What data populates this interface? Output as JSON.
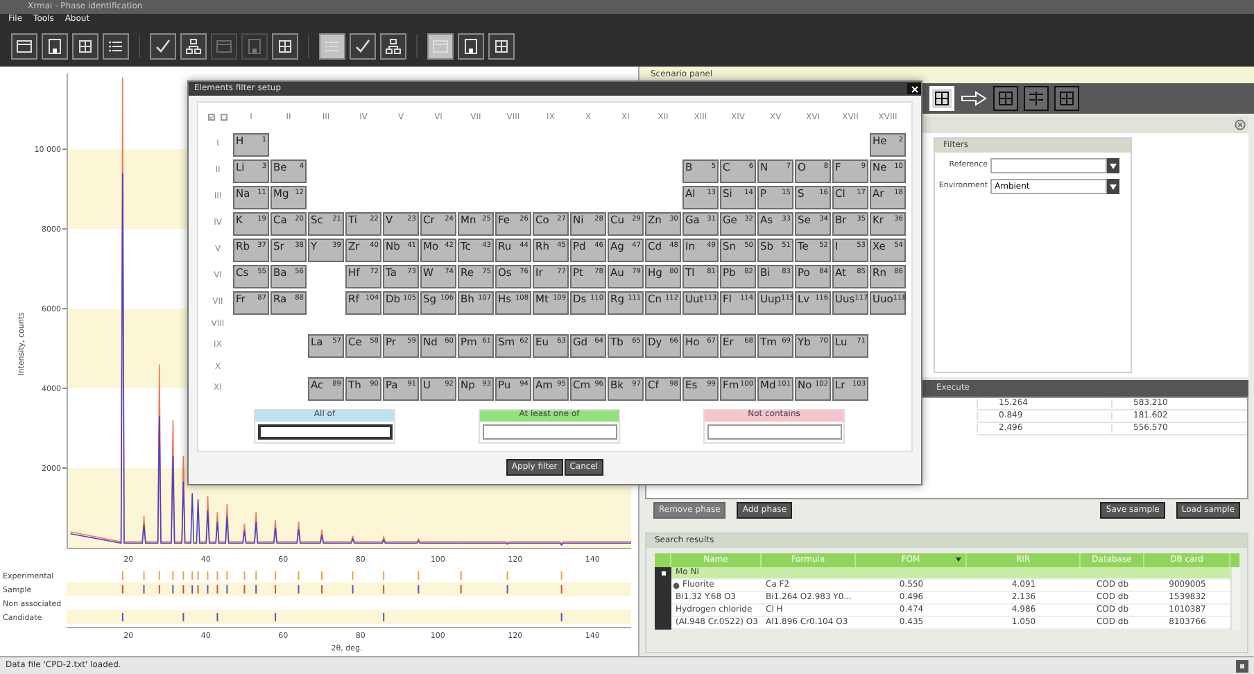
{
  "window": {
    "title": "Xrmai - Phase identification"
  },
  "menu": [
    {
      "label": "File"
    },
    {
      "label": "Tools"
    },
    {
      "label": "About"
    }
  ],
  "toolbar": [
    {
      "selected": false,
      "disabled": false,
      "separator_after": false
    },
    {
      "selected": false,
      "disabled": false,
      "separator_after": false
    },
    {
      "selected": false,
      "disabled": false,
      "separator_after": false
    },
    {
      "selected": false,
      "disabled": false,
      "separator_after": true
    },
    {
      "selected": false,
      "disabled": false,
      "separator_after": false
    },
    {
      "selected": false,
      "disabled": false,
      "separator_after": false
    },
    {
      "selected": false,
      "disabled": true,
      "separator_after": false
    },
    {
      "selected": false,
      "disabled": true,
      "separator_after": false
    },
    {
      "selected": false,
      "disabled": false,
      "separator_after": true
    },
    {
      "selected": true,
      "disabled": false,
      "separator_after": false
    },
    {
      "selected": false,
      "disabled": false,
      "separator_after": false
    },
    {
      "selected": false,
      "disabled": false,
      "separator_after": true
    },
    {
      "selected": true,
      "disabled": false,
      "separator_after": false
    },
    {
      "selected": false,
      "disabled": false,
      "separator_after": false
    },
    {
      "selected": false,
      "disabled": false,
      "separator_after": false
    }
  ],
  "plot": {
    "chart_data": {
      "type": "line",
      "ylabel": "Intensity, counts",
      "xlim": [
        4,
        150
      ],
      "ylim": [
        0,
        11900
      ],
      "xticks": [
        20,
        40,
        60,
        80,
        100,
        120,
        140
      ],
      "yticks": [
        2000,
        4000,
        6000,
        8000,
        {
          "value": 10000,
          "label": "10 000"
        }
      ],
      "x": [
        5,
        18.1,
        18.5,
        18.9,
        23.6,
        24,
        24.4,
        27.6,
        28,
        28.4,
        31.1,
        31.5,
        31.9,
        33.8,
        34.2,
        34.6,
        36.1,
        36.5,
        36.9,
        37.6,
        38,
        38.4,
        40.1,
        40.5,
        40.9,
        42.6,
        43,
        43.4,
        45.1,
        45.5,
        45.9,
        49.6,
        50,
        50.4,
        52.6,
        53,
        53.4,
        57.6,
        58,
        58.4,
        63.6,
        64,
        64.4,
        69.6,
        70,
        70.4,
        77.6,
        78,
        78.4,
        85.6,
        86,
        86.4,
        94.6,
        95,
        95.4,
        105.6,
        106,
        106.4,
        117.6,
        118,
        118.4,
        131.6,
        132,
        132.4,
        150
      ],
      "series": [
        {
          "color": "#f07a5a",
          "values": [
            400,
            150,
            11800,
            150,
            150,
            800,
            150,
            150,
            4600,
            150,
            150,
            3200,
            150,
            150,
            2300,
            150,
            150,
            null,
            null,
            null,
            null,
            150,
            150,
            1300,
            150,
            150,
            900,
            150,
            150,
            1100,
            150,
            150,
            600,
            150,
            150,
            900,
            150,
            150,
            700,
            150,
            150,
            650,
            150,
            150,
            450,
            150,
            150,
            300,
            150,
            150,
            280,
            150,
            150,
            220,
            150,
            150,
            160,
            150,
            150,
            120,
            150,
            150,
            100,
            150,
            150
          ]
        },
        {
          "color": "#4b3fcf",
          "values": [
            350,
            120,
            9400,
            120,
            120,
            580,
            120,
            120,
            3310,
            120,
            120,
            2300,
            120,
            120,
            1660,
            120,
            120,
            1370,
            120,
            120,
            1220,
            120,
            120,
            940,
            120,
            120,
            650,
            120,
            120,
            790,
            120,
            120,
            430,
            120,
            120,
            650,
            120,
            120,
            500,
            120,
            120,
            470,
            120,
            120,
            320,
            120,
            120,
            220,
            120,
            120,
            200,
            120,
            120,
            160,
            120,
            120,
            120,
            120,
            120,
            90,
            120,
            120,
            70,
            120,
            120
          ]
        }
      ]
    },
    "tracks": [
      {
        "label": "Experimental"
      },
      {
        "label": "Sample"
      },
      {
        "label": "Non associated"
      },
      {
        "label": "Candidate"
      }
    ],
    "bottom_x_ticks": [
      "20",
      "40",
      "60",
      "80",
      "100",
      "120",
      "140"
    ],
    "x_label": "2θ, deg."
  },
  "scenario_panel": {
    "title": "Scenario panel",
    "tools": [
      {
        "kind": "button",
        "selected": true
      },
      {
        "kind": "arrow"
      },
      {
        "kind": "button",
        "selected": false
      },
      {
        "kind": "button",
        "selected": false
      },
      {
        "kind": "button",
        "selected": false
      }
    ],
    "filters": {
      "title": "Filters",
      "fields": [
        {
          "label": "Reference"
        },
        {
          "label": "Environment",
          "value": "Ambient"
        }
      ]
    },
    "execute": {
      "title": "Execute",
      "rows": [
        [
          "15.264",
          "583.210"
        ],
        [
          "0.849",
          "181.602"
        ],
        [
          "2.496",
          "556.570"
        ]
      ]
    },
    "left_buttons": [
      {
        "label": "Remove phase",
        "disabled": true
      },
      {
        "label": "Add phase",
        "disabled": false
      }
    ],
    "right_buttons": [
      {
        "label": "Save sample",
        "disabled": false
      },
      {
        "label": "Load sample",
        "disabled": false
      }
    ]
  },
  "search_results": {
    "title": "Search results",
    "columns": [
      {
        "label": "Name",
        "sorted": false
      },
      {
        "label": "Formula",
        "sorted": false
      },
      {
        "label": "FOM",
        "sorted": true
      },
      {
        "label": "RIR",
        "sorted": false
      },
      {
        "label": "Database",
        "sorted": false
      },
      {
        "label": "DB card",
        "sorted": false
      }
    ],
    "rows": [
      {
        "selected": true,
        "current": false,
        "cells": [
          "Mo Ni"
        ]
      },
      {
        "selected": false,
        "current": true,
        "cells": [
          "Fluorite",
          "Ca F2",
          "0.550",
          "4.091",
          "COD db",
          "9009005"
        ]
      },
      {
        "selected": false,
        "current": false,
        "cells": [
          "Bi1.32 Y.68 O3",
          "Bi1.264 O2.983 Y0...",
          "0.496",
          "2.136",
          "COD db",
          "1539832"
        ]
      },
      {
        "selected": false,
        "current": false,
        "cells": [
          "Hydrogen chloride",
          "Cl H",
          "0.474",
          "4.986",
          "COD db",
          "1010387"
        ]
      },
      {
        "selected": false,
        "current": false,
        "cells": [
          "(Al.948 Cr.0522) O3",
          "Al1.896 Cr0.104 O3",
          "0.435",
          "1.050",
          "COD db",
          "8103766"
        ]
      }
    ]
  },
  "dialog": {
    "title": "Elements filter setup",
    "group_labels": [
      "I",
      "II",
      "III",
      "IV",
      "V",
      "VI",
      "VII",
      "VIII",
      "IX",
      "X",
      "XI",
      "XII",
      "XIII",
      "XIV",
      "XV",
      "XVI",
      "XVII",
      "XVIII"
    ],
    "rows": [
      {
        "label": "I",
        "cells": [
          {
            "symbol": "H",
            "number": "1"
          },
          null,
          null,
          null,
          null,
          null,
          null,
          null,
          null,
          null,
          null,
          null,
          null,
          null,
          null,
          null,
          null,
          {
            "symbol": "He",
            "number": "2"
          }
        ]
      },
      {
        "label": "II",
        "cells": [
          {
            "symbol": "Li",
            "number": "3"
          },
          {
            "symbol": "Be",
            "number": "4"
          },
          null,
          null,
          null,
          null,
          null,
          null,
          null,
          null,
          null,
          null,
          {
            "symbol": "B",
            "number": "5"
          },
          {
            "symbol": "C",
            "number": "6"
          },
          {
            "symbol": "N",
            "number": "7"
          },
          {
            "symbol": "O",
            "number": "8"
          },
          {
            "symbol": "F",
            "number": "9"
          },
          {
            "symbol": "Ne",
            "number": "10"
          }
        ]
      },
      {
        "label": "III",
        "cells": [
          {
            "symbol": "Na",
            "number": "11"
          },
          {
            "symbol": "Mg",
            "number": "12"
          },
          null,
          null,
          null,
          null,
          null,
          null,
          null,
          null,
          null,
          null,
          {
            "symbol": "Al",
            "number": "13"
          },
          {
            "symbol": "Si",
            "number": "14"
          },
          {
            "symbol": "P",
            "number": "15"
          },
          {
            "symbol": "S",
            "number": "16"
          },
          {
            "symbol": "Cl",
            "number": "17"
          },
          {
            "symbol": "Ar",
            "number": "18"
          }
        ]
      },
      {
        "label": "IV",
        "cells": [
          {
            "symbol": "K",
            "number": "19"
          },
          {
            "symbol": "Ca",
            "number": "20"
          },
          {
            "symbol": "Sc",
            "number": "21"
          },
          {
            "symbol": "Ti",
            "number": "22"
          },
          {
            "symbol": "V",
            "number": "23"
          },
          {
            "symbol": "Cr",
            "number": "24"
          },
          {
            "symbol": "Mn",
            "number": "25"
          },
          {
            "symbol": "Fe",
            "number": "26"
          },
          {
            "symbol": "Co",
            "number": "27"
          },
          {
            "symbol": "Ni",
            "number": "28"
          },
          {
            "symbol": "Cu",
            "number": "29"
          },
          {
            "symbol": "Zn",
            "number": "30"
          },
          {
            "symbol": "Ga",
            "number": "31"
          },
          {
            "symbol": "Ge",
            "number": "32"
          },
          {
            "symbol": "As",
            "number": "33"
          },
          {
            "symbol": "Se",
            "number": "34"
          },
          {
            "symbol": "Br",
            "number": "35"
          },
          {
            "symbol": "Kr",
            "number": "36"
          }
        ]
      },
      {
        "label": "V",
        "cells": [
          {
            "symbol": "Rb",
            "number": "37"
          },
          {
            "symbol": "Sr",
            "number": "38"
          },
          {
            "symbol": "Y",
            "number": "39"
          },
          {
            "symbol": "Zr",
            "number": "40"
          },
          {
            "symbol": "Nb",
            "number": "41"
          },
          {
            "symbol": "Mo",
            "number": "42"
          },
          {
            "symbol": "Tc",
            "number": "43"
          },
          {
            "symbol": "Ru",
            "number": "44"
          },
          {
            "symbol": "Rh",
            "number": "45"
          },
          {
            "symbol": "Pd",
            "number": "46"
          },
          {
            "symbol": "Ag",
            "number": "47"
          },
          {
            "symbol": "Cd",
            "number": "48"
          },
          {
            "symbol": "In",
            "number": "49"
          },
          {
            "symbol": "Sn",
            "number": "50"
          },
          {
            "symbol": "Sb",
            "number": "51"
          },
          {
            "symbol": "Te",
            "number": "52"
          },
          {
            "symbol": "I",
            "number": "53"
          },
          {
            "symbol": "Xe",
            "number": "54"
          }
        ]
      },
      {
        "label": "VI",
        "cells": [
          {
            "symbol": "Cs",
            "number": "55"
          },
          {
            "symbol": "Ba",
            "number": "56"
          },
          null,
          {
            "symbol": "Hf",
            "number": "72"
          },
          {
            "symbol": "Ta",
            "number": "73"
          },
          {
            "symbol": "W",
            "number": "74"
          },
          {
            "symbol": "Re",
            "number": "75"
          },
          {
            "symbol": "Os",
            "number": "76"
          },
          {
            "symbol": "Ir",
            "number": "77"
          },
          {
            "symbol": "Pt",
            "number": "78"
          },
          {
            "symbol": "Au",
            "number": "79"
          },
          {
            "symbol": "Hg",
            "number": "80"
          },
          {
            "symbol": "Tl",
            "number": "81"
          },
          {
            "symbol": "Pb",
            "number": "82"
          },
          {
            "symbol": "Bi",
            "number": "83"
          },
          {
            "symbol": "Po",
            "number": "84"
          },
          {
            "symbol": "At",
            "number": "85"
          },
          {
            "symbol": "Rn",
            "number": "86"
          }
        ]
      },
      {
        "label": "VII",
        "cells": [
          {
            "symbol": "Fr",
            "number": "87"
          },
          {
            "symbol": "Ra",
            "number": "88"
          },
          null,
          {
            "symbol": "Rf",
            "number": "104"
          },
          {
            "symbol": "Db",
            "number": "105"
          },
          {
            "symbol": "Sg",
            "number": "106"
          },
          {
            "symbol": "Bh",
            "number": "107"
          },
          {
            "symbol": "Hs",
            "number": "108"
          },
          {
            "symbol": "Mt",
            "number": "109"
          },
          {
            "symbol": "Ds",
            "number": "110"
          },
          {
            "symbol": "Rg",
            "number": "111"
          },
          {
            "symbol": "Cn",
            "number": "112"
          },
          {
            "symbol": "Uut",
            "number": "113"
          },
          {
            "symbol": "Fl",
            "number": "114"
          },
          {
            "symbol": "Uup",
            "number": "115"
          },
          {
            "symbol": "Lv",
            "number": "116"
          },
          {
            "symbol": "Uus",
            "number": "117"
          },
          {
            "symbol": "Uuo",
            "number": "118"
          }
        ]
      },
      {
        "label": "VIII"
      },
      {
        "label": "IX",
        "cells": [
          null,
          null,
          {
            "symbol": "La",
            "number": "57"
          },
          {
            "symbol": "Ce",
            "number": "58"
          },
          {
            "symbol": "Pr",
            "number": "59"
          },
          {
            "symbol": "Nd",
            "number": "60"
          },
          {
            "symbol": "Pm",
            "number": "61"
          },
          {
            "symbol": "Sm",
            "number": "62"
          },
          {
            "symbol": "Eu",
            "number": "63"
          },
          {
            "symbol": "Gd",
            "number": "64"
          },
          {
            "symbol": "Tb",
            "number": "65"
          },
          {
            "symbol": "Dy",
            "number": "66"
          },
          {
            "symbol": "Ho",
            "number": "67"
          },
          {
            "symbol": "Er",
            "number": "68"
          },
          {
            "symbol": "Tm",
            "number": "69"
          },
          {
            "symbol": "Yb",
            "number": "70"
          },
          {
            "symbol": "Lu",
            "number": "71"
          },
          null
        ]
      },
      {
        "label": "X"
      },
      {
        "label": "XI",
        "cells": [
          null,
          null,
          {
            "symbol": "Ac",
            "number": "89"
          },
          {
            "symbol": "Th",
            "number": "90"
          },
          {
            "symbol": "Pa",
            "number": "91"
          },
          {
            "symbol": "U",
            "number": "92"
          },
          {
            "symbol": "Np",
            "number": "93"
          },
          {
            "symbol": "Pu",
            "number": "94"
          },
          {
            "symbol": "Am",
            "number": "95"
          },
          {
            "symbol": "Cm",
            "number": "96"
          },
          {
            "symbol": "Bk",
            "number": "97"
          },
          {
            "symbol": "Cf",
            "number": "98"
          },
          {
            "symbol": "Es",
            "number": "99"
          },
          {
            "symbol": "Fm",
            "number": "100"
          },
          {
            "symbol": "Md",
            "number": "101"
          },
          {
            "symbol": "No",
            "number": "102"
          },
          {
            "symbol": "Lr",
            "number": "103"
          },
          null
        ]
      }
    ],
    "filter_boxes": [
      {
        "title": "All of",
        "color": "#bfe2f2",
        "focused": true
      },
      {
        "title": "At least one of",
        "color": "#93e07c",
        "focused": false
      },
      {
        "title": "Not contains",
        "color": "#f7c4cd",
        "focused": false
      }
    ],
    "buttons": [
      {
        "label": "Apply filter"
      },
      {
        "label": "Cancel"
      }
    ]
  },
  "status_bar": {
    "text": "Data file 'CPD-2.txt' loaded."
  }
}
